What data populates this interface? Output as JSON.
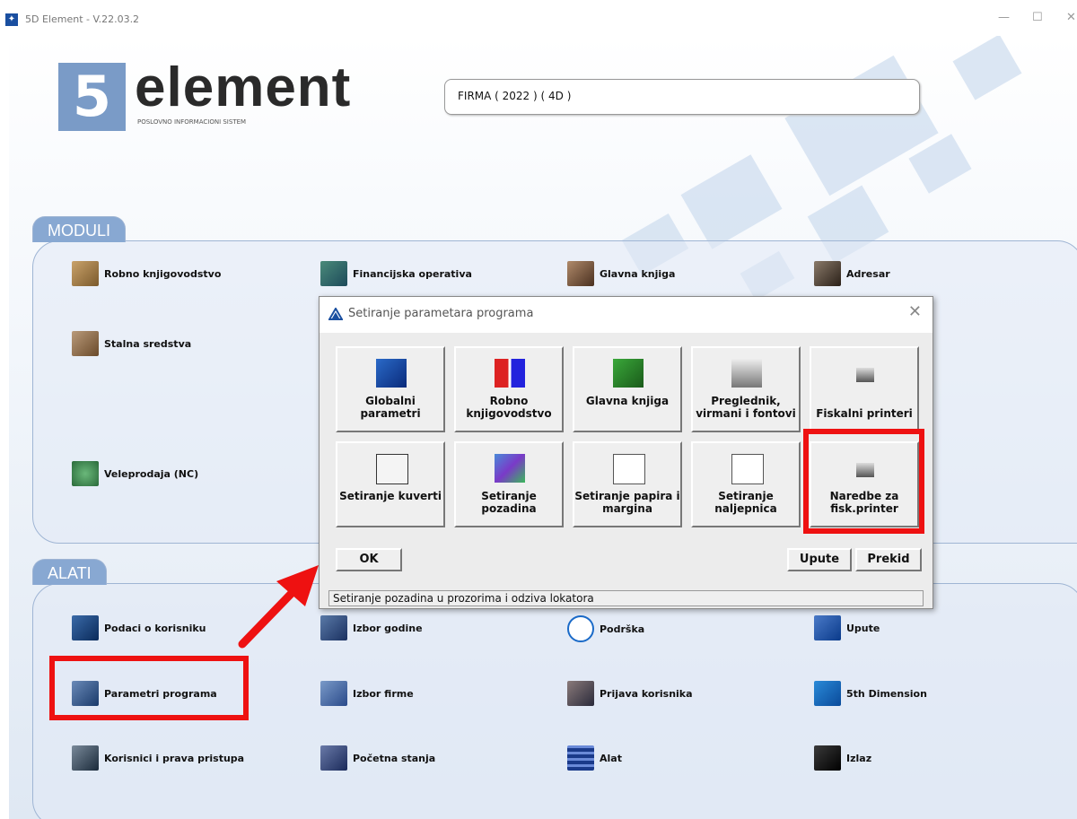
{
  "window": {
    "title": "5D Element - V.22.03.2"
  },
  "logo": {
    "wordmark": "element",
    "subtitle": "POSLOVNO INFORMACIONI SISTEM"
  },
  "company": {
    "value": "FIRMA  ( 2022 ) ( 4D )"
  },
  "moduli": {
    "title": "MODULI",
    "items": [
      "Robno knjigovodstvo",
      "Financijska operativa",
      "Glavna knjiga",
      "Adresar",
      "Stalna sredstva",
      "Veleprodaja (NC)"
    ]
  },
  "alati": {
    "title": "ALATI",
    "items": [
      "Podaci o korisniku",
      "Izbor godine",
      "Podrška",
      "Upute",
      "Parametri programa",
      "Izbor firme",
      "Prijava korisnika",
      "5th Dimension",
      "Korisnici i prava pristupa",
      "Početna stanja",
      "Alat",
      "Izlaz"
    ]
  },
  "dialog": {
    "title": "Setiranje parametara programa",
    "buttons": [
      "Globalni parametri",
      "Robno knjigovodstvo",
      "Glavna knjiga",
      "Preglednik, virmani i fontovi",
      "Fiskalni printeri",
      "Setiranje kuverti",
      "Setiranje pozadina",
      "Setiranje papira i margina",
      "Setiranje naljepnica",
      "Naredbe za fisk.printer"
    ],
    "ok": "OK",
    "upute": "Upute",
    "prekid": "Prekid",
    "status": "Setiranje pozadina u prozorima i odziva lokatora"
  },
  "colors": {
    "highlight": "#ee1111",
    "accent": "#88a8d2"
  }
}
